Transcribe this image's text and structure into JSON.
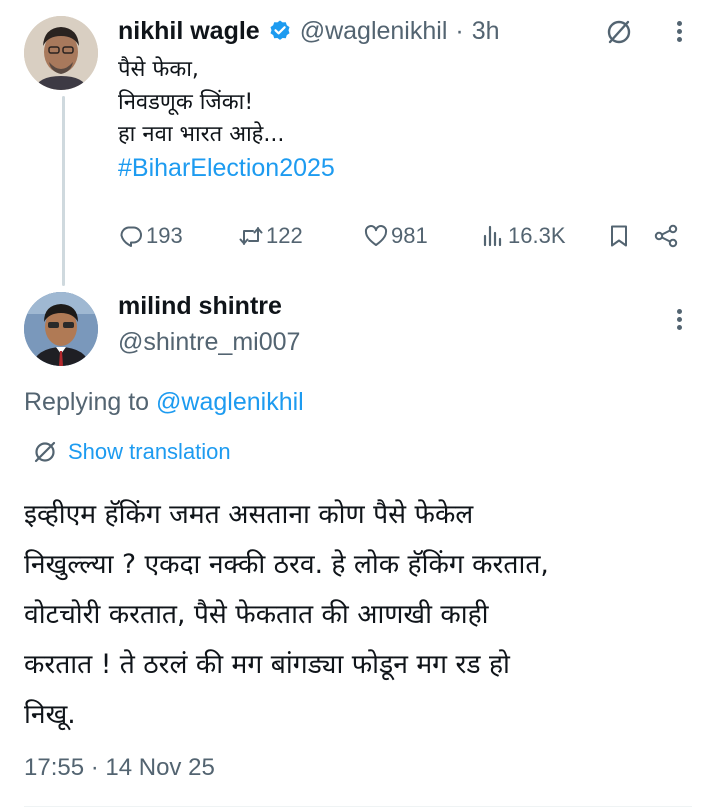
{
  "original_tweet": {
    "author_name": "nikhil wagle",
    "author_handle": "@waglenikhil",
    "separator": "·",
    "time_ago": "3h",
    "verified": true,
    "lines": [
      "पैसे फेका,",
      "निवडणूक जिंका!",
      "हा नवा भारत आहे..."
    ],
    "hashtag": "#BiharElection2025",
    "stats": {
      "replies": "193",
      "reposts": "122",
      "likes": "981",
      "views": "16.3K"
    }
  },
  "reply_tweet": {
    "author_name": "milind shintre",
    "author_handle": "@shintre_mi007",
    "replying_prefix": "Replying to",
    "replying_to": "@waglenikhil",
    "translate_label": "Show translation",
    "lines": [
      "इव्हीएम हॅकिंग जमत असताना कोण पैसे फेकेल",
      "निखुल्ल्या  ? एकदा नक्की ठरव. हे लोक हॅकिंग करतात,",
      "वोटचोरी करतात, पैसे फेकतात की आणखी काही",
      "करतात  !  ते ठरलं की मग बांगड्या फोडून मग रड हो",
      "निखू."
    ],
    "timestamp": "17:55 · 14 Nov 25"
  },
  "colors": {
    "accent": "#1d9bf0",
    "muted": "#536471",
    "text": "#0f1419",
    "thread_line": "#cfd9de"
  },
  "icons": [
    "verified-badge-icon",
    "grok-icon",
    "more-icon",
    "reply-icon",
    "repost-icon",
    "like-icon",
    "views-icon",
    "bookmark-icon",
    "share-icon",
    "translate-icon"
  ]
}
